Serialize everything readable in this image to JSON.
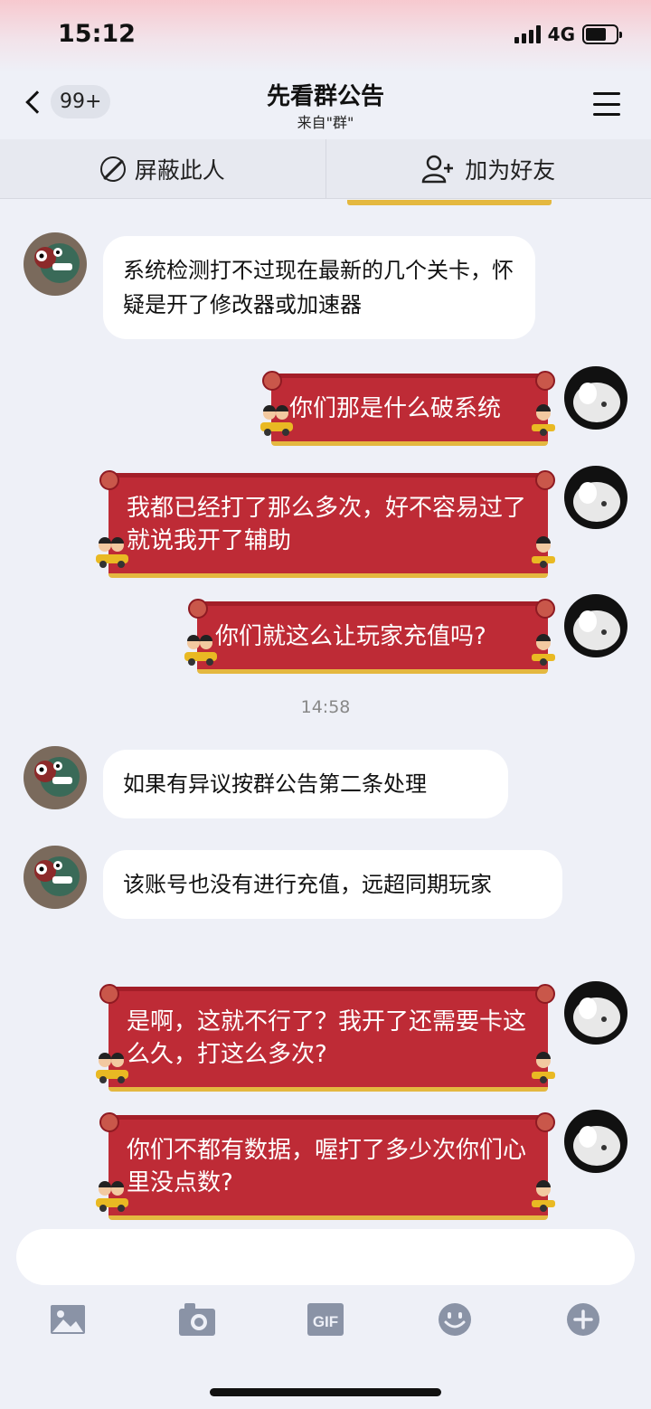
{
  "status_bar": {
    "time": "15:12",
    "network": "4G",
    "battery_level": 0.68
  },
  "nav": {
    "back_badge": "99+",
    "title": "先看群公告",
    "subtitle": "来自\"群\""
  },
  "actions": {
    "block": "屏蔽此人",
    "add_friend": "加为好友"
  },
  "messages": [
    {
      "side": "left",
      "text": "系统检测打不过现在最新的几个关卡，怀疑是开了修改器或加速器"
    },
    {
      "side": "right",
      "text": "你们那是什么破系统"
    },
    {
      "side": "right",
      "text": "我都已经打了那么多次，好不容易过了就说我开了辅助"
    },
    {
      "side": "right",
      "text": "你们就这么让玩家充值吗?"
    },
    {
      "side": "left",
      "text": "如果有异议按群公告第二条处理"
    },
    {
      "side": "left",
      "text": "该账号也没有进行充值，远超同期玩家"
    },
    {
      "side": "right",
      "text": "是啊，这就不行了？我开了还需要卡这么久，打这么多次?"
    },
    {
      "side": "right",
      "text": "你们不都有数据，喔打了多少次你们心里没点数?"
    }
  ],
  "timestamp": "14:58",
  "input": {
    "placeholder": ""
  },
  "toolbar": [
    "image-icon",
    "camera-icon",
    "gif-icon",
    "emoji-icon",
    "plus-icon"
  ],
  "colors": {
    "bubble_red": "#be2b36",
    "bubble_gold": "#e4b840",
    "background": "#eef0f7"
  }
}
